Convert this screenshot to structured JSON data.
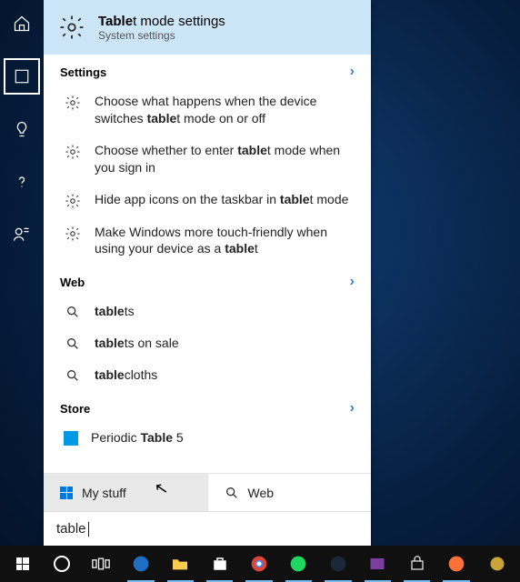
{
  "rail": {
    "items": [
      {
        "name": "home-icon"
      },
      {
        "name": "box-icon"
      },
      {
        "name": "bulb-icon"
      },
      {
        "name": "help-icon"
      },
      {
        "name": "feedback-icon"
      }
    ]
  },
  "best_match": {
    "title_prefix": "Table",
    "title_suffix": "t mode settings",
    "subtitle": "System settings"
  },
  "sections": {
    "settings": {
      "label": "Settings",
      "items": [
        {
          "pre": "Choose what happens when the device switches ",
          "bold": "table",
          "post": "t mode on or off"
        },
        {
          "pre": "Choose whether to enter ",
          "bold": "table",
          "post": "t mode when you sign in"
        },
        {
          "pre": "Hide app icons on the taskbar in ",
          "bold": "table",
          "post": "t mode"
        },
        {
          "pre": "Make Windows more touch-friendly when using your device as a ",
          "bold": "table",
          "post": "t"
        }
      ]
    },
    "web": {
      "label": "Web",
      "items": [
        {
          "bold": "table",
          "post": "ts"
        },
        {
          "bold": "table",
          "post": "ts on sale"
        },
        {
          "bold": "table",
          "post": "cloths"
        }
      ]
    },
    "store": {
      "label": "Store",
      "items": [
        {
          "pre": "Periodic ",
          "bold": "Table",
          "post": " 5"
        }
      ]
    }
  },
  "bottom": {
    "my_stuff": "My stuff",
    "web": "Web"
  },
  "search": {
    "query": "table"
  },
  "taskbar": {
    "items": [
      "start",
      "cortana",
      "taskview",
      "edge",
      "explorer",
      "store-tb",
      "chrome",
      "spotify",
      "steam",
      "onenote",
      "bag",
      "firefox",
      "tray"
    ]
  }
}
